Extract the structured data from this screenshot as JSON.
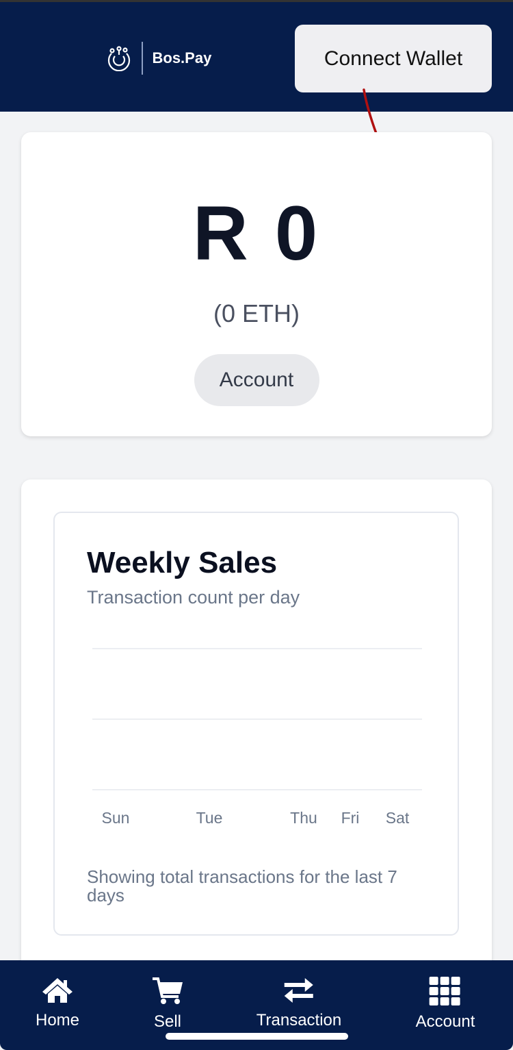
{
  "header": {
    "brand": "Bos.Pay",
    "connect_label": "Connect Wallet"
  },
  "balance": {
    "amount": "R 0",
    "eth": "(0 ETH)",
    "account_label": "Account"
  },
  "chart_data": {
    "type": "bar",
    "title": "Weekly Sales",
    "subtitle": "Transaction count per day",
    "categories": [
      "Sun",
      "Tue",
      "Thu",
      "Fri",
      "Sat"
    ],
    "values": [
      0,
      0,
      0,
      0,
      0
    ],
    "grid": true,
    "footer": "Showing total transactions for the last 7 days"
  },
  "nav": {
    "items": [
      {
        "label": "Home",
        "icon": "home-icon"
      },
      {
        "label": "Sell",
        "icon": "cart-icon"
      },
      {
        "label": "Transaction",
        "icon": "swap-icon"
      },
      {
        "label": "Account",
        "icon": "grid-icon"
      }
    ]
  },
  "colors": {
    "navy": "#061d4b",
    "annotation": "#b01010"
  }
}
